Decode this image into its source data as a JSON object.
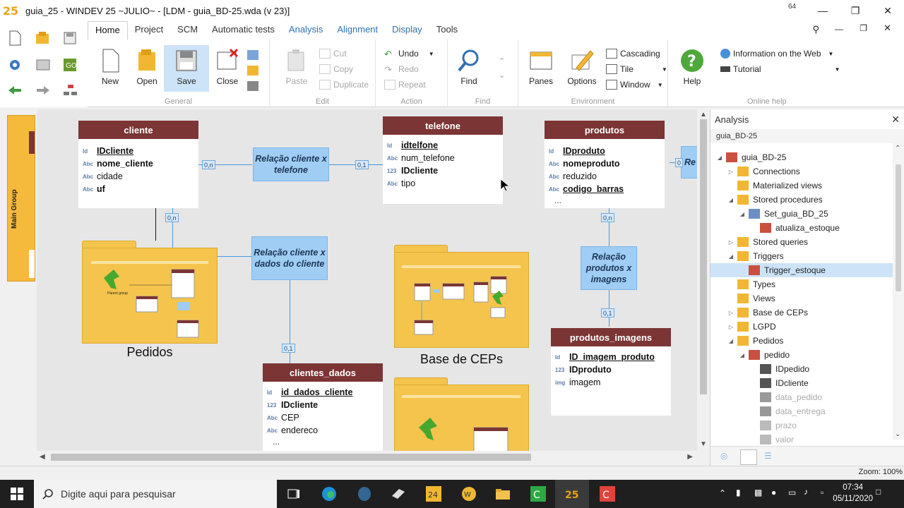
{
  "window": {
    "title": "guia_25 - WINDEV 25 ~JULIO~ - [LDM - guia_BD-25.wda (v 23)]",
    "badge": "64"
  },
  "ribbon": {
    "tabs": [
      {
        "label": "Home"
      },
      {
        "label": "Project"
      },
      {
        "label": "SCM"
      },
      {
        "label": "Automatic tests"
      },
      {
        "label": "Analysis"
      },
      {
        "label": "Alignment"
      },
      {
        "label": "Display"
      },
      {
        "label": "Tools"
      }
    ],
    "groups": {
      "general": "General",
      "edit": "Edit",
      "action": "Action",
      "find": "Find",
      "environment": "Environment",
      "online_help": "Online help"
    },
    "buttons": {
      "new": "New",
      "open": "Open",
      "save": "Save",
      "close": "Close",
      "paste": "Paste",
      "cut": "Cut",
      "copy": "Copy",
      "duplicate": "Duplicate",
      "undo": "Undo",
      "redo": "Redo",
      "repeat": "Repeat",
      "find": "Find",
      "panes": "Panes",
      "options": "Options",
      "cascading": "Cascading",
      "tile": "Tile",
      "window": "Window",
      "help": "Help",
      "info_web": "Information on the Web",
      "tutorial": "Tutorial"
    }
  },
  "diagram": {
    "main_group": "Main Group",
    "entities": {
      "cliente": {
        "title": "cliente",
        "fields": [
          {
            "type": "Id",
            "name": "IDcliente"
          },
          {
            "type": "Abc",
            "name": "nome_cliente"
          },
          {
            "type": "Abc",
            "name": "cidade"
          },
          {
            "type": "Abc",
            "name": "uf"
          }
        ]
      },
      "telefone": {
        "title": "telefone",
        "fields": [
          {
            "type": "Id",
            "name": "idtelfone"
          },
          {
            "type": "Abc",
            "name": "num_telefone"
          },
          {
            "type": "123",
            "name": "IDcliente"
          },
          {
            "type": "Abc",
            "name": "tipo"
          }
        ]
      },
      "produtos": {
        "title": "produtos",
        "fields": [
          {
            "type": "Id",
            "name": "IDproduto"
          },
          {
            "type": "Abc",
            "name": "nomeproduto"
          },
          {
            "type": "Abc",
            "name": "reduzido"
          },
          {
            "type": "Abc",
            "name": "codigo_barras"
          }
        ],
        "more": "..."
      },
      "produtos_imagens": {
        "title": "produtos_imagens",
        "fields": [
          {
            "type": "Id",
            "name": "ID_imagem_produto"
          },
          {
            "type": "123",
            "name": "IDproduto"
          },
          {
            "type": "img",
            "name": "imagem"
          }
        ]
      },
      "clientes_dados": {
        "title": "clientes_dados",
        "fields": [
          {
            "type": "Id",
            "name": "id_dados_cliente"
          },
          {
            "type": "123",
            "name": "IDcliente"
          },
          {
            "type": "Abc",
            "name": "CEP"
          },
          {
            "type": "Abc",
            "name": "endereco"
          }
        ],
        "more": "..."
      }
    },
    "relations": {
      "cliente_telefone": "Relação cliente x telefone",
      "cliente_dados": "Relação cliente x dados do cliente",
      "produtos_imagens": "Relação produtos x imagens",
      "partial": "Re"
    },
    "cardinalities": {
      "c1": "0,n",
      "c2": "0,1",
      "c3": "0,n",
      "c4": "0,1",
      "c5": "0,n",
      "c6": "0,1",
      "c7": "0"
    },
    "folders": {
      "pedidos": "Pedidos",
      "base_ceps": "Base de CEPs",
      "parent_group": "Parent group"
    }
  },
  "panel": {
    "title": "Analysis",
    "subtitle": "guia_BD-25",
    "tree": [
      {
        "label": "guia_BD-25",
        "indent": 0,
        "twist": "◢"
      },
      {
        "label": "Connections",
        "indent": 1,
        "twist": "▷"
      },
      {
        "label": "Materialized views",
        "indent": 1,
        "twist": ""
      },
      {
        "label": "Stored procedures",
        "indent": 1,
        "twist": "◢"
      },
      {
        "label": "Set_guia_BD_25",
        "indent": 2,
        "twist": "◢"
      },
      {
        "label": "atualiza_estoque",
        "indent": 3,
        "twist": ""
      },
      {
        "label": "Stored queries",
        "indent": 1,
        "twist": "▷"
      },
      {
        "label": "Triggers",
        "indent": 1,
        "twist": "◢"
      },
      {
        "label": "Trigger_estoque",
        "indent": 2,
        "twist": ""
      },
      {
        "label": "Types",
        "indent": 1,
        "twist": ""
      },
      {
        "label": "Views",
        "indent": 1,
        "twist": ""
      },
      {
        "label": "Base de CEPs",
        "indent": 1,
        "twist": "▷"
      },
      {
        "label": "LGPD",
        "indent": 1,
        "twist": "▷"
      },
      {
        "label": "Pedidos",
        "indent": 1,
        "twist": "◢"
      },
      {
        "label": "pedido",
        "indent": 2,
        "twist": "◢"
      },
      {
        "label": "IDpedido",
        "indent": 3,
        "twist": ""
      },
      {
        "label": "IDcliente",
        "indent": 3,
        "twist": ""
      },
      {
        "label": "data_pedido",
        "indent": 3,
        "twist": ""
      },
      {
        "label": "data_entrega",
        "indent": 3,
        "twist": ""
      },
      {
        "label": "prazo",
        "indent": 3,
        "twist": ""
      },
      {
        "label": "valor",
        "indent": 3,
        "twist": ""
      }
    ]
  },
  "status": {
    "zoom": "Zoom: 100%"
  },
  "taskbar": {
    "search_placeholder": "Digite aqui para pesquisar",
    "time": "07:34",
    "date": "05/11/2020"
  }
}
